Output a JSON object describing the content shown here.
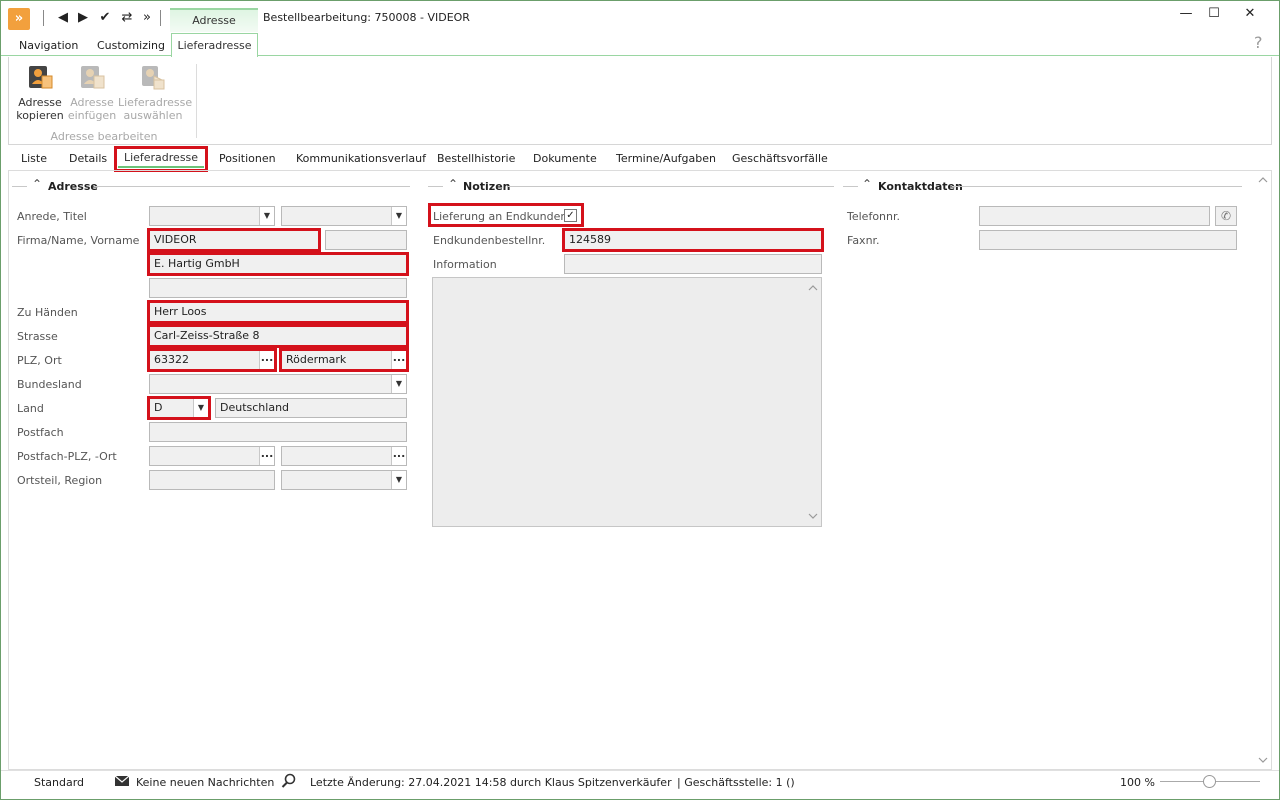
{
  "window": {
    "title": "Bestellbearbeitung: 750008 - VIDEOR",
    "context_tab_group": "Adresse",
    "minimize": "—",
    "maximize": "☐",
    "close": "✕"
  },
  "quick_access": [
    "◀",
    "▶",
    "✔",
    "⇄",
    "»"
  ],
  "ribbon_tabs": {
    "navigation": "Navigation",
    "customizing": "Customizing",
    "active": "Lieferadresse",
    "help": "?"
  },
  "ribbon": {
    "buttons": [
      {
        "label1": "Adresse",
        "label2": "kopieren",
        "enabled": true
      },
      {
        "label1": "Adresse",
        "label2": "einfügen",
        "enabled": false
      },
      {
        "label1": "Lieferadresse",
        "label2": "auswählen",
        "enabled": false
      }
    ],
    "group_label": "Adresse bearbeiten"
  },
  "tabs": {
    "liste": "Liste",
    "details": "Details",
    "lieferadresse": "Lieferadresse",
    "positionen": "Positionen",
    "kommunikation": "Kommunikationsverlauf",
    "bestellhistorie": "Bestellhistorie",
    "dokumente": "Dokumente",
    "termine": "Termine/Aufgaben",
    "geschaeftsvorfaelle": "Geschäftsvorfälle"
  },
  "sections": {
    "adresse": "Adresse",
    "notizen": "Notizen",
    "kontakt": "Kontaktdaten"
  },
  "address": {
    "labels": {
      "anrede": "Anrede, Titel",
      "firma": "Firma/Name, Vorname",
      "zu_haenden": "Zu Händen",
      "strasse": "Strasse",
      "plz_ort": "PLZ, Ort",
      "bundesland": "Bundesland",
      "land": "Land",
      "postfach": "Postfach",
      "postfach_plz": "Postfach-PLZ, -Ort",
      "ortsteil": "Ortsteil, Region"
    },
    "values": {
      "firma": "VIDEOR",
      "firma2": "E. Hartig GmbH",
      "zu_haenden": "Herr Loos",
      "strasse": "Carl-Zeiss-Straße 8",
      "plz": "63322",
      "ort": "Rödermark",
      "land_code": "D",
      "land_name": "Deutschland"
    }
  },
  "notes": {
    "lieferung_label": "Lieferung an Endkunden",
    "lieferung_checked": "✓",
    "endkundenbestell_label": "Endkundenbestellnr.",
    "endkundenbestell_value": "124589",
    "information_label": "Information"
  },
  "contact": {
    "telefon_label": "Telefonnr.",
    "fax_label": "Faxnr."
  },
  "status": {
    "profile": "Standard",
    "messages": "Keine neuen Nachrichten",
    "last_change": "Letzte Änderung: 27.04.2021 14:58 durch Klaus Spitzenverkäufer",
    "branch": "| Geschäftsstelle:   1 ()",
    "zoom": "100 %"
  }
}
